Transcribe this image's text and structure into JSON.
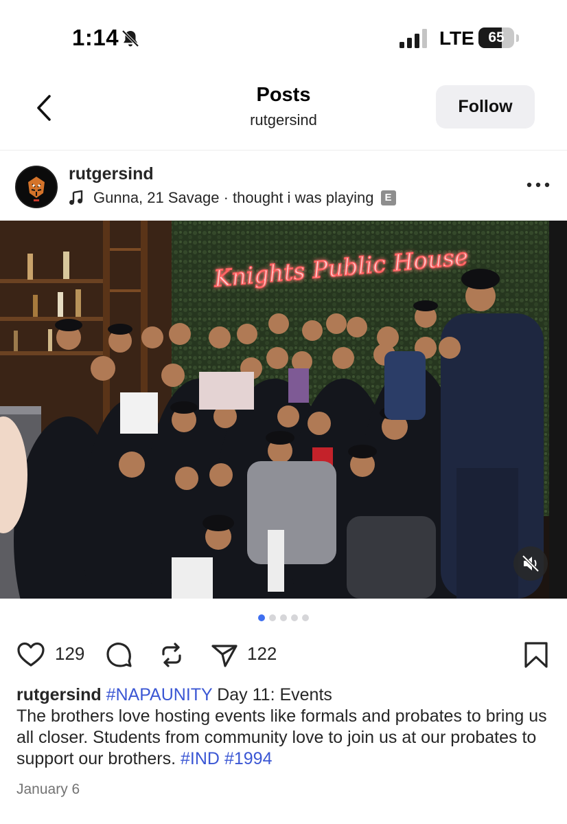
{
  "status_bar": {
    "time": "1:14",
    "network": "LTE",
    "battery": "65",
    "battery_level": 0.65
  },
  "nav": {
    "title": "Posts",
    "subtitle": "rutgersind",
    "follow_label": "Follow"
  },
  "post": {
    "username": "rutgersind",
    "audio": "Gunna, 21 Savage · thought i was playing",
    "explicit": "E",
    "photo_sign": "Knights Public House",
    "carousel": {
      "count": 5,
      "active": 1
    },
    "likes": "129",
    "shares": "122",
    "caption": {
      "username": "rutgersind",
      "hashtag1": "#NAPAUNITY",
      "text1": "Day 11: Events",
      "text2": "The brothers love hosting events like formals and probates to bring us all closer. Students from community love to join us at our probates to support our brothers.",
      "hashtag2": "#IND",
      "hashtag3": "#1994"
    },
    "date": "January 6"
  },
  "colors": {
    "accent": "#3b57d4",
    "neon": "#ff5a5a",
    "dot_active": "#3f6ff0",
    "button_bg": "#efeff2"
  },
  "icons": {
    "back": "chevron-left-icon",
    "mute": "speaker-muted-icon",
    "like": "heart-icon",
    "comment": "comment-bubble-icon",
    "repost": "repost-icon",
    "share": "paper-plane-icon",
    "save": "bookmark-icon",
    "more": "ellipsis-icon"
  }
}
